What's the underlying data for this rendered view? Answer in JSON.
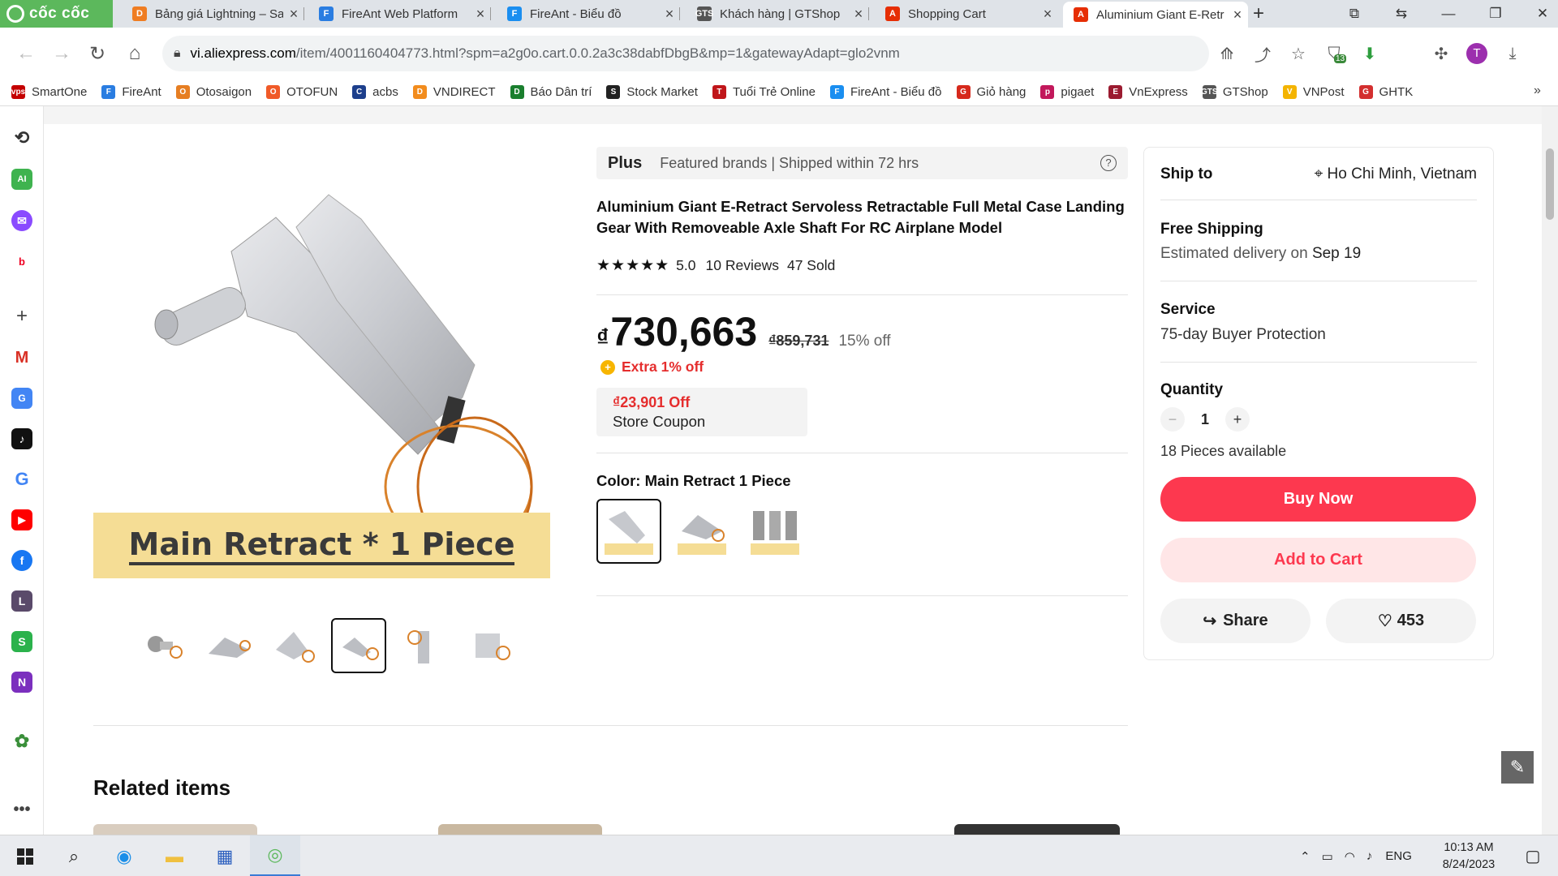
{
  "browser": {
    "brand": "cốc cốc",
    "tabs": [
      {
        "label": "Bảng giá Lightning – Sa",
        "color": "#ef7d22",
        "glyph": "D"
      },
      {
        "label": "FireAnt Web Platform",
        "color": "#2a7de1",
        "glyph": "F"
      },
      {
        "label": "FireAnt - Biểu đồ",
        "color": "#1a8ef0",
        "glyph": "F"
      },
      {
        "label": "Khách hàng | GTShop",
        "color": "#555",
        "glyph": "GTS"
      },
      {
        "label": "Shopping Cart",
        "color": "#e62e04",
        "glyph": "A"
      },
      {
        "label": "Aluminium Giant E-Retr",
        "color": "#e62e04",
        "glyph": "A"
      }
    ],
    "url": "vi.aliexpress.com/item/4001160404773.html?spm=a2g0o.cart.0.0.2a3c38dabfDbgB&mp=1&gatewayAdapt=glo2vnm",
    "url_host": "vi.aliexpress.com",
    "url_rest": "/item/4001160404773.html?spm=a2g0o.cart.0.0.2a3c38dabfDbgB&mp=1&gatewayAdapt=glo2vnm",
    "extension_badge": "13",
    "profile_initial": "T"
  },
  "bookmarks": [
    {
      "label": "SmartOne",
      "color": "#c40000",
      "glyph": "vps"
    },
    {
      "label": "FireAnt",
      "color": "#2a7de1",
      "glyph": "F"
    },
    {
      "label": "Otosaigon",
      "color": "#e67e22",
      "glyph": "O"
    },
    {
      "label": "OTOFUN",
      "color": "#f05a28",
      "glyph": "O"
    },
    {
      "label": "acbs",
      "color": "#1d3f8c",
      "glyph": "C"
    },
    {
      "label": "VNDIRECT",
      "color": "#f28c1d",
      "glyph": "D"
    },
    {
      "label": "Báo Dân trí",
      "color": "#1a7f2e",
      "glyph": "D"
    },
    {
      "label": "Stock Market",
      "color": "#222",
      "glyph": "S"
    },
    {
      "label": "Tuổi Trẻ Online",
      "color": "#c0161a",
      "glyph": "T"
    },
    {
      "label": "FireAnt - Biểu đồ",
      "color": "#1a8ef0",
      "glyph": "F"
    },
    {
      "label": "Giỏ hàng",
      "color": "#d6291c",
      "glyph": "G"
    },
    {
      "label": "pigaet",
      "color": "#c2185b",
      "glyph": "p"
    },
    {
      "label": "VnExpress",
      "color": "#9b1b30",
      "glyph": "E"
    },
    {
      "label": "GTShop",
      "color": "#555",
      "glyph": "GTS"
    },
    {
      "label": "VNPost",
      "color": "#f4b400",
      "glyph": "V"
    },
    {
      "label": "GHTK",
      "color": "#d32f2f",
      "glyph": "G"
    }
  ],
  "product": {
    "main_image_caption": "Main Retract * 1 Piece",
    "plus_badge": "Plus",
    "plus_text": "Featured brands | Shipped within 72 hrs",
    "help_icon": "?",
    "title": "Aluminium Giant E-Retract Servoless Retractable Full Metal Case Landing Gear With Removeable Axle Shaft For RC Airplane Model",
    "rating_stars": "★★★★★",
    "rating": "5.0",
    "reviews": "10 Reviews",
    "sold": "47 Sold",
    "currency": "₫",
    "price": "730,663",
    "old_price": "₫859,731",
    "discount": "15% off",
    "extra_icon": "+",
    "extra_off": "Extra 1% off",
    "coupon_amount": "₫23,901 Off",
    "coupon_label": "Store Coupon",
    "color_label": "Color: Main Retract 1 Piece",
    "related_title": "Related items"
  },
  "panel": {
    "ship_to_label": "Ship to",
    "ship_to_value": "Ho Chi Minh, Vietnam",
    "free_shipping": "Free Shipping",
    "delivery_prefix": "Estimated delivery on",
    "delivery_date": "Sep 19",
    "service_label": "Service",
    "service_value": "75-day Buyer Protection",
    "quantity_label": "Quantity",
    "quantity": "1",
    "minus": "−",
    "plus": "+",
    "available": "18 Pieces available",
    "buy_now": "Buy Now",
    "add_to_cart": "Add to Cart",
    "share": "Share",
    "wishlist_count": "453",
    "share_icon": "↪",
    "heart_icon": "♡"
  },
  "taskbar": {
    "language": "ENG",
    "time": "10:13 AM",
    "date": "8/24/2023"
  }
}
